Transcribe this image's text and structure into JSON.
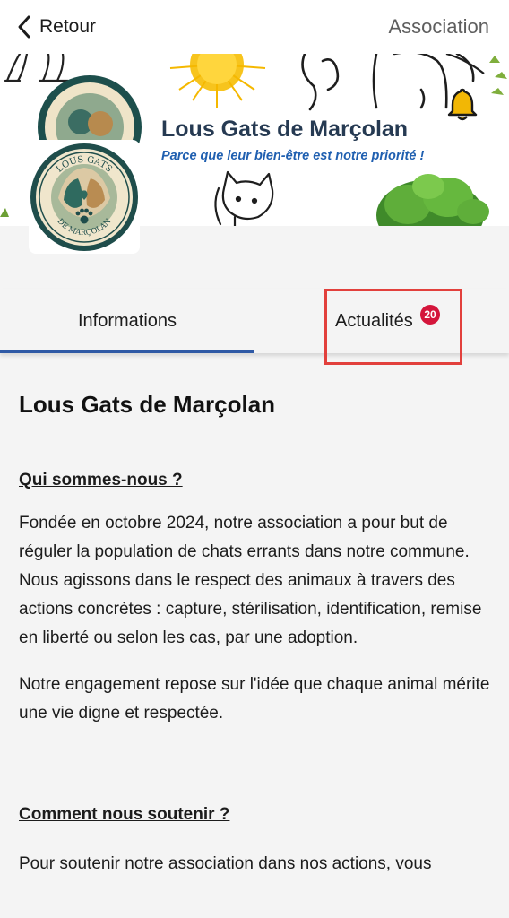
{
  "header": {
    "back_label": "Retour",
    "title": "Association"
  },
  "banner": {
    "title": "Lous Gats de Marçolan",
    "tagline": "Parce que leur bien-être est notre priorité !",
    "logo_text_top": "LOUS GATS",
    "logo_text_bottom": "DE MARÇOLAN",
    "colors": {
      "title": "#263a52",
      "tagline": "#1f5fb0",
      "bell": "#f2b705"
    },
    "icons": [
      "bell-icon",
      "sun-illustration",
      "cat-illustration",
      "tree-illustration"
    ]
  },
  "tabs": {
    "info_label": "Informations",
    "news_label": "Actualités",
    "news_badge": "20",
    "active": "Informations",
    "accent_color": "#2f5aa6",
    "badge_color": "#d4153b"
  },
  "content": {
    "heading": "Lous Gats de Marçolan",
    "section1_title": "Qui sommes-nous ?",
    "section1_p1": "Fondée en octobre 2024, notre association a pour but de réguler la population de chats errants dans notre commune. Nous agissons dans le respect des animaux à travers des actions concrètes : capture, stérilisation, identification, remise en liberté ou selon les cas, par une adoption.",
    "section1_p2": "Notre engagement repose sur l'idée que chaque animal mérite une vie digne et respectée.",
    "section2_title": "Comment nous soutenir ?",
    "section2_p1": "Pour soutenir notre association dans nos actions, vous"
  }
}
